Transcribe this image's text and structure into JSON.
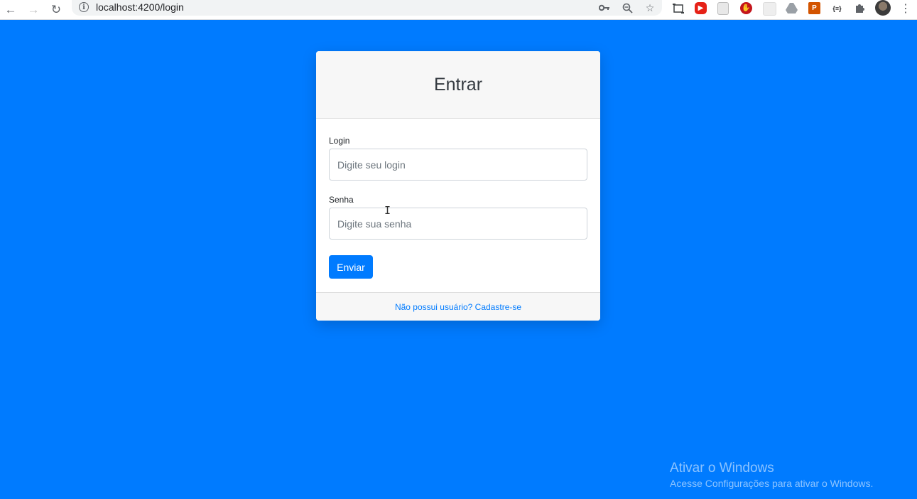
{
  "browser": {
    "url": "localhost:4200/login",
    "back_icon": "arrow-left-icon",
    "forward_icon": "arrow-right-icon",
    "reload_icon": "reload-icon",
    "omnibox_icons": [
      "key-icon",
      "zoom-out-icon",
      "star-icon"
    ],
    "extensions": [
      "screenshot-icon",
      "youtube-icon",
      "document-icon",
      "adblock-icon",
      "grid-icon",
      "drive-icon",
      "pdf-icon",
      "json-icon",
      "puzzle-icon"
    ]
  },
  "card": {
    "title": "Entrar",
    "login_label": "Login",
    "login_placeholder": "Digite seu login",
    "password_label": "Senha",
    "password_placeholder": "Digite sua senha",
    "submit_label": "Enviar",
    "signup_link": "Não possui usuário? Cadastre-se"
  },
  "watermark": {
    "title": "Ativar o Windows",
    "subtitle": "Acesse Configurações para ativar o Windows."
  },
  "colors": {
    "background": "#007bff",
    "primary": "#007bff",
    "card_header": "#f7f7f7"
  }
}
